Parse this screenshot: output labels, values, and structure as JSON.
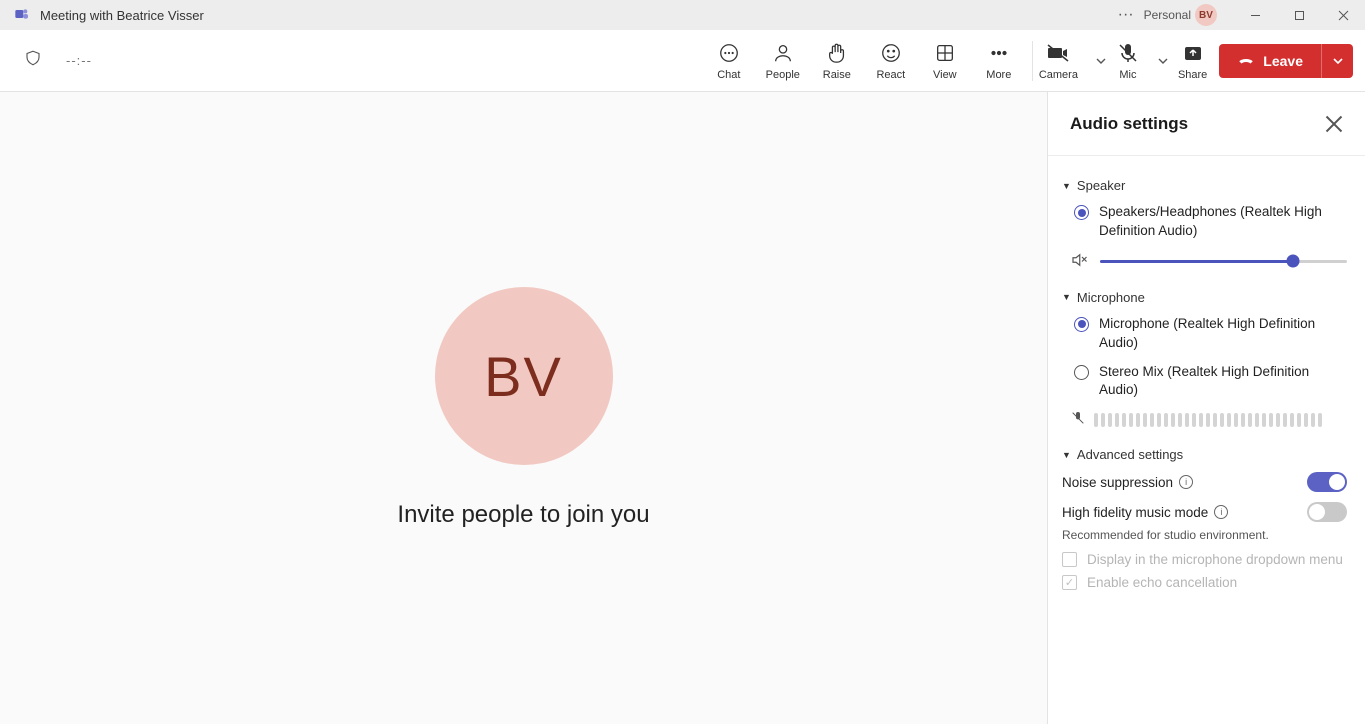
{
  "titlebar": {
    "title": "Meeting with Beatrice Visser",
    "personal": "Personal",
    "avatar": "BV"
  },
  "toolbar": {
    "timer": "--:--",
    "chat": "Chat",
    "people": "People",
    "raise": "Raise",
    "react": "React",
    "view": "View",
    "more": "More",
    "camera": "Camera",
    "mic": "Mic",
    "share": "Share",
    "leave": "Leave"
  },
  "stage": {
    "avatar": "BV",
    "invite": "Invite people to join you"
  },
  "panel": {
    "title": "Audio settings",
    "speaker": {
      "section": "Speaker",
      "option1": "Speakers/Headphones (Realtek High Definition Audio)"
    },
    "microphone": {
      "section": "Microphone",
      "option1": "Microphone (Realtek High Definition Audio)",
      "option2": "Stereo Mix (Realtek High Definition Audio)"
    },
    "advanced": {
      "section": "Advanced settings",
      "noise": "Noise suppression",
      "hifi": "High fidelity music mode",
      "hifi_sub": "Recommended for studio environment.",
      "chk1": "Display in the microphone dropdown menu",
      "chk2": "Enable echo cancellation"
    }
  }
}
